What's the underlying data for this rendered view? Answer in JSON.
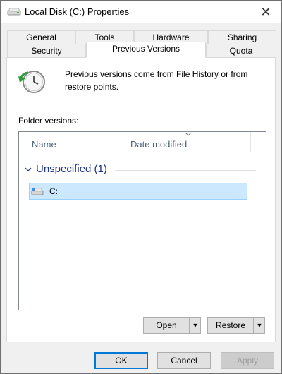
{
  "window": {
    "title": "Local Disk (C:) Properties",
    "close_glyph": "✕"
  },
  "tabs": {
    "row1": [
      "General",
      "Tools",
      "Hardware",
      "Sharing"
    ],
    "row2": [
      "Security",
      "Previous Versions",
      "Quota"
    ],
    "active": "Previous Versions"
  },
  "panel": {
    "intro_text": "Previous versions come from File History or from restore points.",
    "folder_versions_label": "Folder versions:",
    "list": {
      "columns": [
        "Name",
        "Date modified"
      ],
      "group_title": "Unspecified (1)",
      "items": [
        {
          "name": "C:",
          "date_modified": ""
        }
      ]
    },
    "open_button": "Open",
    "restore_button": "Restore",
    "dropdown_glyph": "▼"
  },
  "footer": {
    "ok": "OK",
    "cancel": "Cancel",
    "apply": "Apply"
  },
  "colors": {
    "selection_bg": "#cce8ff",
    "group_title": "#1e3287",
    "accent": "#0078d7"
  },
  "icons": [
    "drive-icon",
    "close-icon",
    "clock-restore-icon",
    "chevron-down-icon",
    "dropdown-arrow-icon"
  ]
}
